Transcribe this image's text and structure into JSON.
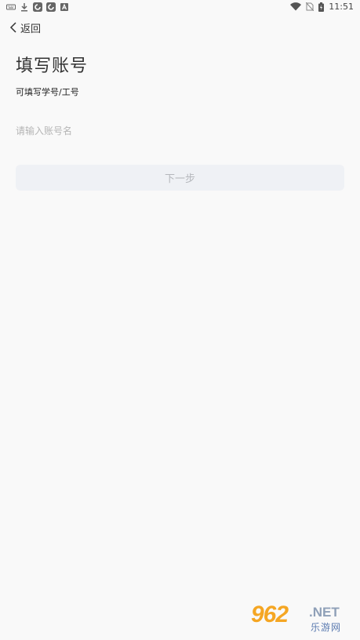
{
  "status_bar": {
    "time": "11:51"
  },
  "nav": {
    "back_label": "返回"
  },
  "page": {
    "title": "填写账号",
    "subtitle": "可填写学号/工号",
    "input_placeholder": "请输入账号名",
    "next_button_label": "下一步"
  },
  "watermark": {
    "number": "962",
    "net": ".NET",
    "site_name": "乐游网"
  }
}
